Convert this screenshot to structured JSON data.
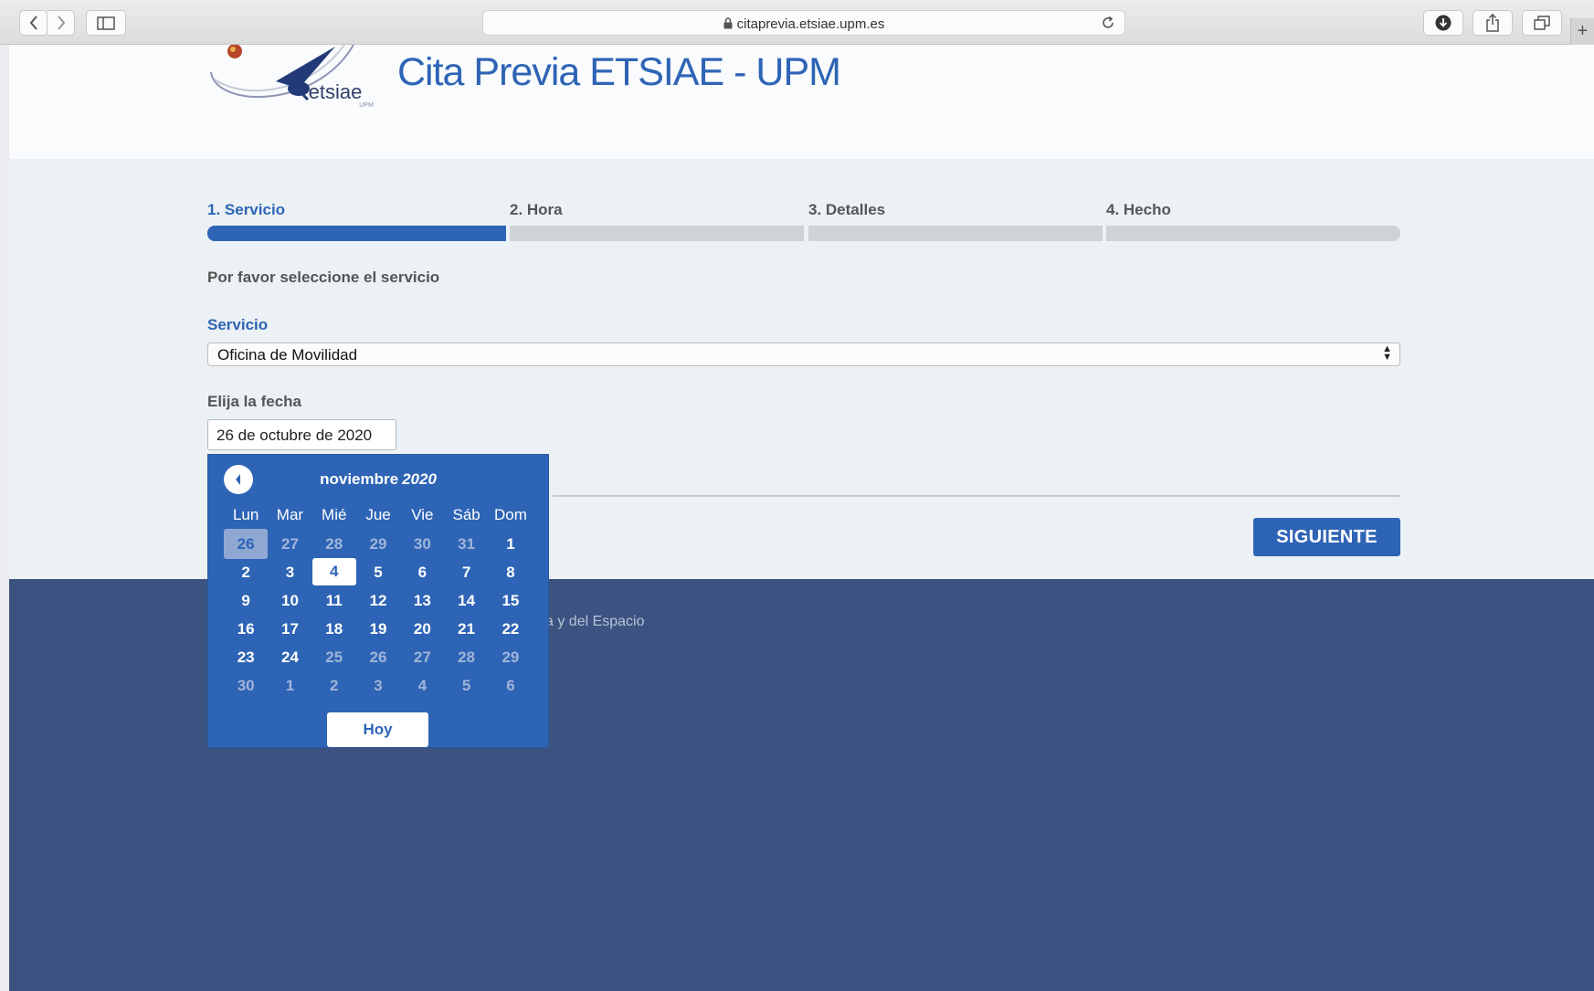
{
  "browser": {
    "url": "citaprevia.etsiae.upm.es",
    "plus_label": "+"
  },
  "header": {
    "logo_text": "etsiae",
    "logo_subtext": "UPM",
    "title": "Cita Previa ETSIAE - UPM"
  },
  "steps": [
    {
      "label": "1. Servicio",
      "active": true
    },
    {
      "label": "2. Hora",
      "active": false
    },
    {
      "label": "3. Detalles",
      "active": false
    },
    {
      "label": "4. Hecho",
      "active": false
    }
  ],
  "form": {
    "instruction": "Por favor seleccione el servicio",
    "service_label": "Servicio",
    "service_value": "Oficina de Movilidad",
    "date_label": "Elija la fecha",
    "date_value": "26 de octubre de 2020",
    "next_label": "SIGUIENTE"
  },
  "footer": {
    "text": "a y del Espacio"
  },
  "datepicker": {
    "month": "noviembre",
    "year": "2020",
    "weekdays": [
      "Lun",
      "Mar",
      "Mié",
      "Jue",
      "Vie",
      "Sáb",
      "Dom"
    ],
    "weeks": [
      [
        {
          "d": "26",
          "m": true,
          "sel": true
        },
        {
          "d": "27",
          "m": true
        },
        {
          "d": "28",
          "m": true
        },
        {
          "d": "29",
          "m": true
        },
        {
          "d": "30",
          "m": true
        },
        {
          "d": "31",
          "m": true
        },
        {
          "d": "1"
        }
      ],
      [
        {
          "d": "2"
        },
        {
          "d": "3"
        },
        {
          "d": "4",
          "today": true
        },
        {
          "d": "5"
        },
        {
          "d": "6"
        },
        {
          "d": "7"
        },
        {
          "d": "8"
        }
      ],
      [
        {
          "d": "9"
        },
        {
          "d": "10"
        },
        {
          "d": "11"
        },
        {
          "d": "12"
        },
        {
          "d": "13"
        },
        {
          "d": "14"
        },
        {
          "d": "15"
        }
      ],
      [
        {
          "d": "16"
        },
        {
          "d": "17"
        },
        {
          "d": "18"
        },
        {
          "d": "19"
        },
        {
          "d": "20"
        },
        {
          "d": "21"
        },
        {
          "d": "22"
        }
      ],
      [
        {
          "d": "23"
        },
        {
          "d": "24"
        },
        {
          "d": "25",
          "m": true
        },
        {
          "d": "26",
          "m": true
        },
        {
          "d": "27",
          "m": true
        },
        {
          "d": "28",
          "m": true
        },
        {
          "d": "29",
          "m": true
        }
      ],
      [
        {
          "d": "30",
          "m": true
        },
        {
          "d": "1",
          "m": true
        },
        {
          "d": "2",
          "m": true
        },
        {
          "d": "3",
          "m": true
        },
        {
          "d": "4",
          "m": true
        },
        {
          "d": "5",
          "m": true
        },
        {
          "d": "6",
          "m": true
        }
      ]
    ],
    "today_label": "Hoy"
  },
  "colors": {
    "accent": "#2e64b5",
    "footer": "#3c5382",
    "page_bg": "#ebf1f4"
  }
}
